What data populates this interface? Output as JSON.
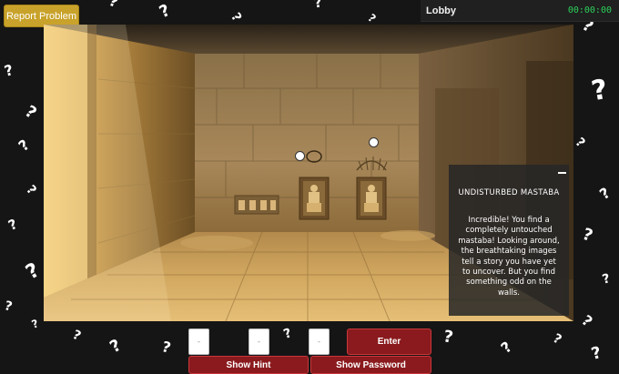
{
  "header": {
    "report_button": "Report Problem",
    "lobby_title": "Lobby",
    "timer": "00:00:00"
  },
  "scene": {
    "name": "undisturbed-mastaba-tomb",
    "info_panel": {
      "title": "UNDISTURBED MASTABA",
      "text": "Incredible! You find a completely untouched mastaba! Looking around, the breathtaking images tell a story you have yet to uncover. But you find something odd on the walls."
    }
  },
  "code_entry": {
    "digit_placeholder": "-",
    "enter_label": "Enter"
  },
  "footer": {
    "show_hint": "Show Hint",
    "show_password": "Show Password"
  },
  "colors": {
    "background": "#151515",
    "report_button": "#c8a22a",
    "action_red": "#8a1a1d",
    "timer_green": "#2bd15a"
  }
}
